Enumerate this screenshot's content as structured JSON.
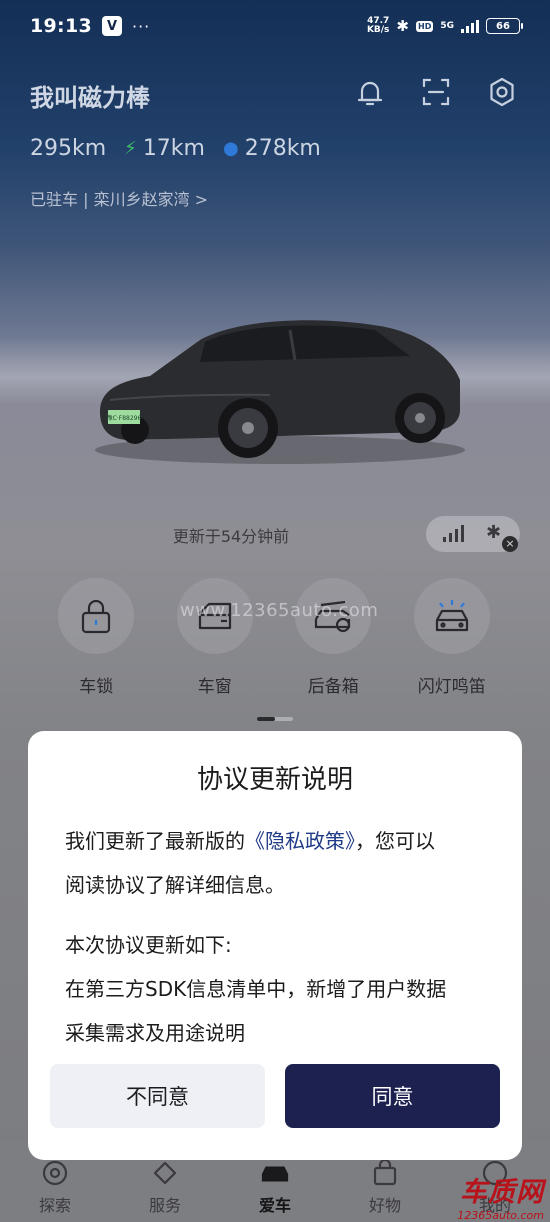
{
  "status_bar": {
    "time": "19:13",
    "app_icon": "V",
    "dots": "···",
    "net_speed_value": "47.7",
    "net_speed_unit": "KB/s",
    "hd": "HD",
    "network": "5G",
    "battery": "66"
  },
  "header": {
    "car_name": "我叫磁力棒",
    "icons": [
      "bell-icon",
      "scan-icon",
      "gear-icon"
    ]
  },
  "range": {
    "total": "295km",
    "electric": "17km",
    "fuel": "278km"
  },
  "location": "已驻车 | 栾川乡赵家湾  >",
  "license_plate": "豫C·F88296",
  "update_text": "更新于54分钟前",
  "controls": [
    {
      "label": "车锁",
      "icon": "lock-icon"
    },
    {
      "label": "车窗",
      "icon": "car-window-icon"
    },
    {
      "label": "后备箱",
      "icon": "trunk-icon"
    },
    {
      "label": "闪灯鸣笛",
      "icon": "flash-horn-icon"
    }
  ],
  "watermark": "www.12365auto.com",
  "bottom_nav": [
    {
      "label": "探索",
      "icon": "explore-icon"
    },
    {
      "label": "服务",
      "icon": "service-icon"
    },
    {
      "label": "爱车",
      "icon": "car-icon"
    },
    {
      "label": "好物",
      "icon": "shop-icon"
    },
    {
      "label": "我的",
      "icon": "profile-icon"
    }
  ],
  "brand_watermark": {
    "name": "车质网",
    "url": "12365auto.com"
  },
  "dialog": {
    "title": "协议更新说明",
    "line1_prefix": "我们更新了最新版的",
    "line1_link": "《隐私政策》",
    "line1_suffix": "，您可以",
    "line2": "阅读协议了解详细信息。",
    "line3": "本次协议更新如下:",
    "line4": "在第三方SDK信息清单中，新增了用户数据",
    "line5": "采集需求及用途说明",
    "disagree_label": "不同意",
    "agree_label": "同意"
  },
  "colors": {
    "agree_button": "#1c2150",
    "link": "#1f3a86",
    "header_top": "#142f56"
  }
}
